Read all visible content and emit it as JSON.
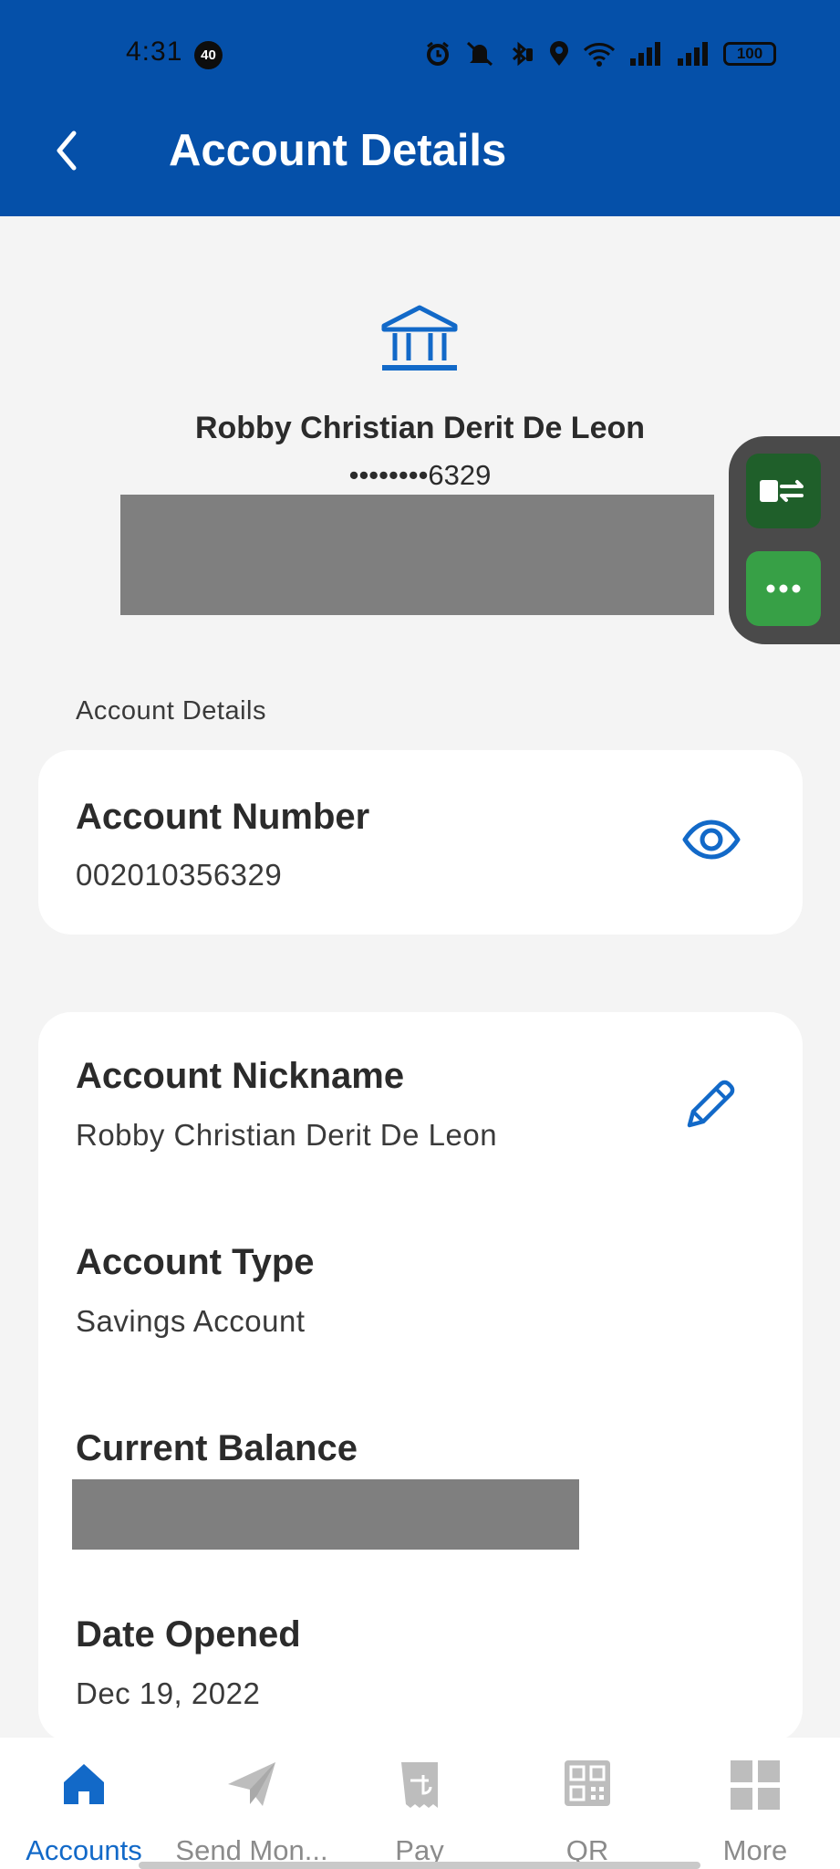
{
  "status_bar": {
    "time": "4:31",
    "notification_count": "40",
    "battery": "100"
  },
  "header": {
    "title": "Account Details"
  },
  "account": {
    "holder_name": "Robby Christian Derit De Leon",
    "masked_number": "••••••••6329"
  },
  "section_label": "Account Details",
  "account_number_card": {
    "label": "Account Number",
    "value": "002010356329"
  },
  "details_card": {
    "nickname_label": "Account Nickname",
    "nickname_value": "Robby Christian Derit De Leon",
    "type_label": "Account Type",
    "type_value": "Savings Account",
    "balance_label": "Current Balance",
    "date_label": "Date Opened",
    "date_value": "Dec 19, 2022"
  },
  "bottom_nav": {
    "items": [
      {
        "label": "Accounts",
        "icon": "home-icon",
        "active": true
      },
      {
        "label": "Send Mon...",
        "icon": "paper-plane-icon",
        "active": false
      },
      {
        "label": "Pay",
        "icon": "receipt-icon",
        "active": false
      },
      {
        "label": "QR",
        "icon": "qr-code-icon",
        "active": false
      },
      {
        "label": "More",
        "icon": "grid-icon",
        "active": false
      }
    ]
  },
  "colors": {
    "header_bg": "#0550a9",
    "accent": "#1269c8",
    "redaction": "#7f7f7f"
  }
}
